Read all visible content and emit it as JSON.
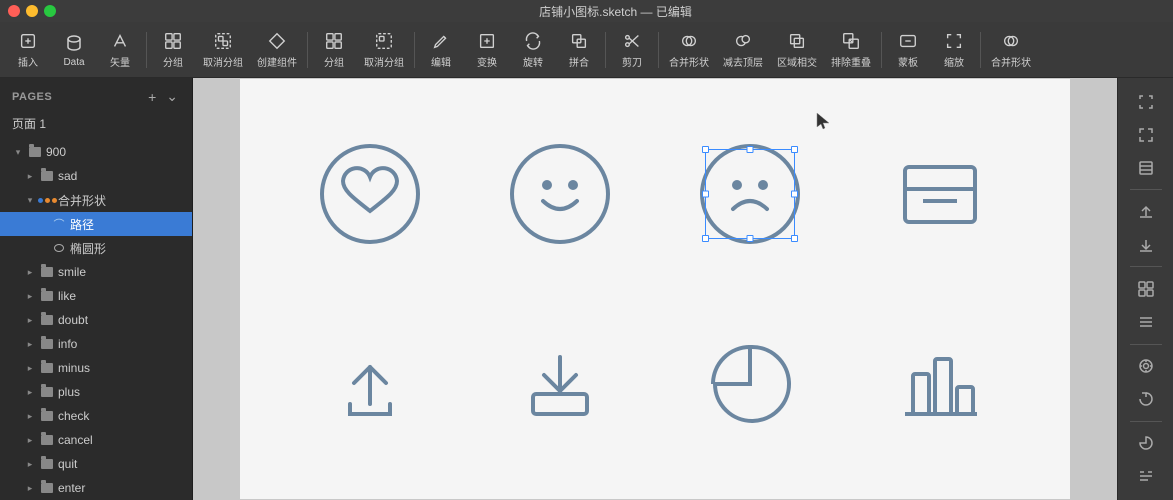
{
  "titlebar": {
    "title": "店铺小图标.sketch — 已编辑"
  },
  "toolbar": {
    "items": [
      {
        "id": "insert",
        "label": "插入",
        "icon": "plus"
      },
      {
        "id": "data",
        "label": "Data",
        "icon": "data"
      },
      {
        "id": "vector",
        "label": "矢量",
        "icon": "vector"
      },
      {
        "id": "group",
        "label": "分组",
        "icon": "group"
      },
      {
        "id": "ungroup",
        "label": "取消分组",
        "icon": "ungroup"
      },
      {
        "id": "component",
        "label": "创建组件",
        "icon": "component"
      },
      {
        "id": "group2",
        "label": "分组",
        "icon": "group"
      },
      {
        "id": "ungroup2",
        "label": "取消分组",
        "icon": "ungroup"
      },
      {
        "id": "edit",
        "label": "编辑",
        "icon": "edit"
      },
      {
        "id": "transform",
        "label": "变换",
        "icon": "transform"
      },
      {
        "id": "rotate",
        "label": "旋转",
        "icon": "rotate"
      },
      {
        "id": "combine",
        "label": "拼合",
        "icon": "combine"
      },
      {
        "id": "clip",
        "label": "剪刀",
        "icon": "scissors"
      },
      {
        "id": "merge",
        "label": "合并形状",
        "icon": "merge"
      },
      {
        "id": "subtract",
        "label": "减去顶层",
        "icon": "subtract"
      },
      {
        "id": "intersect",
        "label": "区域相交",
        "icon": "intersect"
      },
      {
        "id": "dedup",
        "label": "排除重叠",
        "icon": "dedup"
      },
      {
        "id": "template",
        "label": "蒙板",
        "icon": "mask"
      },
      {
        "id": "zoom",
        "label": "缩放",
        "icon": "zoom"
      },
      {
        "id": "merge2",
        "label": "合并形状",
        "icon": "merge2"
      }
    ]
  },
  "sidebar": {
    "pages_title": "PAGES",
    "add_page_label": "+",
    "pages": [
      {
        "id": "page1",
        "label": "页面 1"
      }
    ],
    "layers": [
      {
        "id": "900",
        "label": "900",
        "type": "group",
        "expanded": true,
        "indent": 0
      },
      {
        "id": "sad",
        "label": "sad",
        "type": "folder",
        "indent": 1
      },
      {
        "id": "merge-shape",
        "label": "合并形状",
        "type": "merge",
        "indent": 1,
        "dots": [
          "blue",
          "orange",
          "orange"
        ]
      },
      {
        "id": "path",
        "label": "路径",
        "type": "path",
        "indent": 2,
        "selected": true
      },
      {
        "id": "oval",
        "label": "椭圆形",
        "type": "oval",
        "indent": 2
      },
      {
        "id": "smile",
        "label": "smile",
        "type": "folder",
        "indent": 1
      },
      {
        "id": "like",
        "label": "like",
        "type": "folder",
        "indent": 1
      },
      {
        "id": "doubt",
        "label": "doubt",
        "type": "folder",
        "indent": 1
      },
      {
        "id": "info",
        "label": "info",
        "type": "folder",
        "indent": 1
      },
      {
        "id": "minus",
        "label": "minus",
        "type": "folder",
        "indent": 1
      },
      {
        "id": "plus",
        "label": "plus",
        "type": "folder",
        "indent": 1
      },
      {
        "id": "check",
        "label": "check",
        "type": "folder",
        "indent": 1
      },
      {
        "id": "cancel",
        "label": "cancel",
        "type": "folder",
        "indent": 1
      },
      {
        "id": "quit",
        "label": "quit",
        "type": "folder",
        "indent": 1
      },
      {
        "id": "enter",
        "label": "enter",
        "type": "folder",
        "indent": 1
      }
    ]
  },
  "canvas": {
    "icons": [
      {
        "id": "heart",
        "type": "heart",
        "row": 0,
        "col": 0
      },
      {
        "id": "smile-face",
        "type": "smile",
        "row": 0,
        "col": 1
      },
      {
        "id": "sad-face",
        "type": "sad",
        "row": 0,
        "col": 2,
        "selected": true
      },
      {
        "id": "box",
        "type": "box",
        "row": 0,
        "col": 3
      },
      {
        "id": "upload",
        "type": "upload",
        "row": 1,
        "col": 0
      },
      {
        "id": "download",
        "type": "download",
        "row": 1,
        "col": 1
      },
      {
        "id": "pie-chart",
        "type": "pie",
        "row": 1,
        "col": 2
      },
      {
        "id": "bar-chart",
        "type": "bar",
        "row": 1,
        "col": 3
      }
    ]
  },
  "colors": {
    "icon_stroke": "#6b86a0",
    "selected_border": "#3a8bff",
    "sidebar_selected": "#3a7bd5",
    "bg_dark": "#2b2b2b",
    "bg_toolbar": "#3a3a3a",
    "canvas_bg": "#f5f5f5"
  }
}
